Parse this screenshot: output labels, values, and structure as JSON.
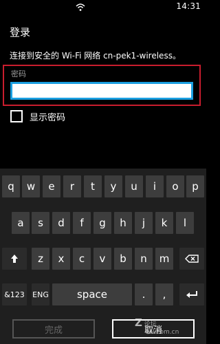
{
  "status_bar": {
    "time": "14:31",
    "wifi_icon": "wifi-icon"
  },
  "page": {
    "title": "登录",
    "connect_text": "连接到安全的 Wi-Fi 网络 cn-pek1-wireless。",
    "password_label": "密码",
    "password_value": "",
    "show_password_label": "显示密码",
    "show_password_checked": false
  },
  "keyboard": {
    "row1": [
      "q",
      "w",
      "e",
      "r",
      "t",
      "y",
      "u",
      "i",
      "o",
      "p"
    ],
    "row2": [
      "a",
      "s",
      "d",
      "f",
      "g",
      "h",
      "j",
      "k",
      "l"
    ],
    "row3": [
      "z",
      "x",
      "c",
      "v",
      "b",
      "n",
      "m"
    ],
    "shift_icon": "shift-arrow-icon",
    "backspace_icon": "backspace-icon",
    "enter_icon": "enter-icon",
    "symbols_label": "&123",
    "lang_label": "ENG",
    "space_label": "space",
    "dot_label": ".",
    "comma_label": ","
  },
  "bottom_bar": {
    "done_label": "完成",
    "cancel_label": "取消"
  },
  "watermark": {
    "logo": "Z",
    "site": "论坛",
    "domain": "zol.com.cn"
  },
  "colors": {
    "accent_blue": "#1b9fe0",
    "error_red": "#c91d2e",
    "key_bg": "#3d3d3d",
    "keyboard_bg": "#1f1f1f"
  }
}
